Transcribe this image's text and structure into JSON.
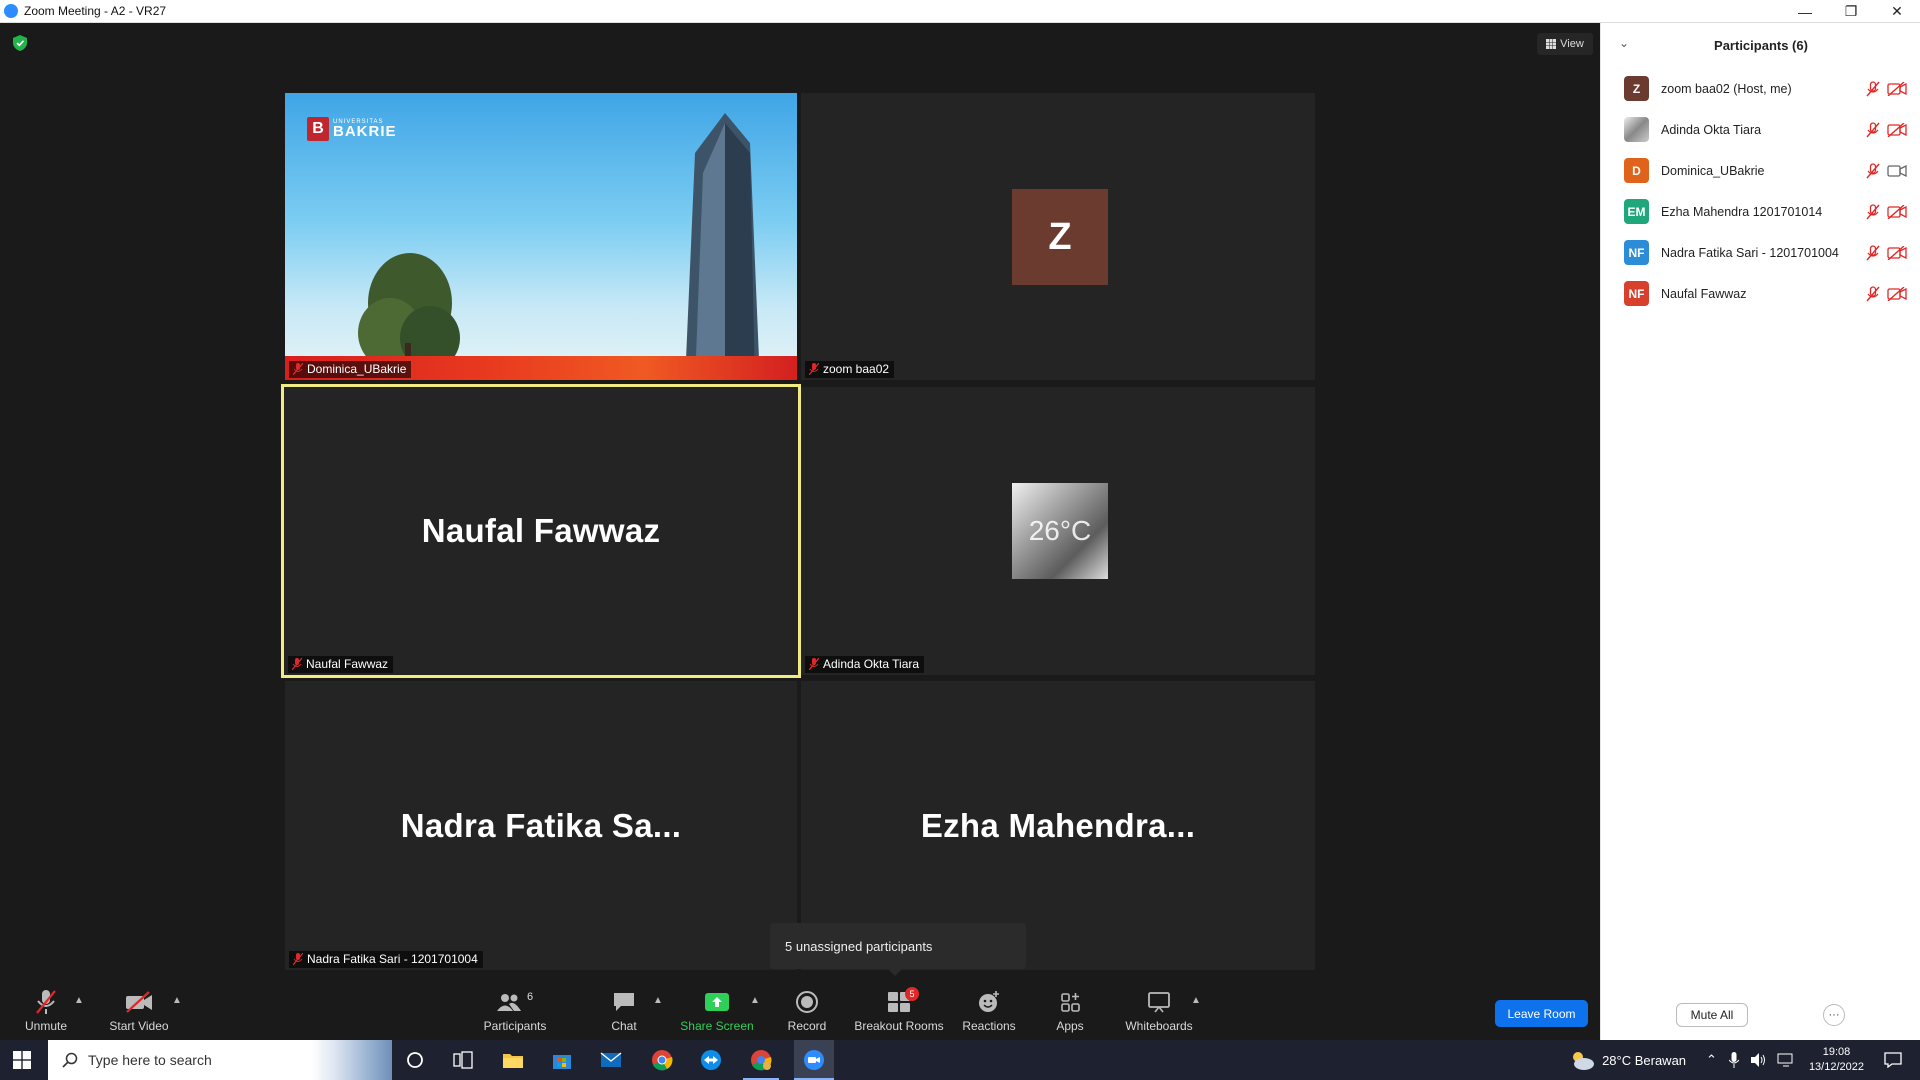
{
  "window": {
    "title": "Zoom Meeting - A2 - VR27"
  },
  "meeting": {
    "view_label": "View",
    "tiles": [
      {
        "id": "dominica",
        "name_tag": "Dominica_UBakrie",
        "content": "video-image"
      },
      {
        "id": "zoom-baa02",
        "name_tag": "zoom baa02",
        "avatar_letter": "Z"
      },
      {
        "id": "naufal",
        "name_tag": "Naufal Fawwaz",
        "big_name": "Naufal Fawwaz",
        "active_speaker": true
      },
      {
        "id": "adinda",
        "name_tag": "Adinda Okta Tiara",
        "avatar_text": "26°C"
      },
      {
        "id": "nadra",
        "name_tag": "Nadra Fatika Sari - 1201701004",
        "big_name": "Nadra Fatika Sa..."
      },
      {
        "id": "ezha",
        "name_tag": "",
        "big_name": "Ezha  Mahendra..."
      }
    ],
    "logo": {
      "small": "UNIVERSITAS",
      "big": "BAKRIE",
      "letter": "B"
    }
  },
  "tooltip": {
    "text": "5 unassigned participants"
  },
  "toolbar": {
    "unmute": "Unmute",
    "start_video": "Start Video",
    "participants": "Participants",
    "participants_count": "6",
    "chat": "Chat",
    "share_screen": "Share Screen",
    "record": "Record",
    "breakout_rooms": "Breakout Rooms",
    "breakout_badge": "5",
    "reactions": "Reactions",
    "apps": "Apps",
    "whiteboards": "Whiteboards",
    "leave_room": "Leave Room"
  },
  "panel": {
    "title": "Participants (6)",
    "participants": [
      {
        "initials": "Z",
        "name": "zoom baa02 (Host, me)",
        "color": "#6b3b2f",
        "video": "off"
      },
      {
        "initials": "",
        "name": "Adinda Okta Tiara",
        "color": "#9a9a9a",
        "video": "off",
        "photo": true
      },
      {
        "initials": "D",
        "name": "Dominica_UBakrie",
        "color": "#e0631b",
        "video": "on"
      },
      {
        "initials": "EM",
        "name": "Ezha Mahendra 1201701014",
        "color": "#1fa67a",
        "video": "off"
      },
      {
        "initials": "NF",
        "name": "Nadra Fatika Sari - 1201701004",
        "color": "#2d8cd6",
        "video": "off"
      },
      {
        "initials": "NF",
        "name": "Naufal Fawwaz",
        "color": "#d6402d",
        "video": "off"
      }
    ],
    "mute_all": "Mute All",
    "more": "···"
  },
  "taskbar": {
    "search_placeholder": "Type here to search",
    "weather": "28°C  Berawan",
    "time": "19:08",
    "date": "13/12/2022"
  },
  "colors": {
    "accent": "#0e72ed",
    "share_green": "#2fd05a",
    "active_speaker": "#f2eb84",
    "mute_red": "#e02828"
  }
}
